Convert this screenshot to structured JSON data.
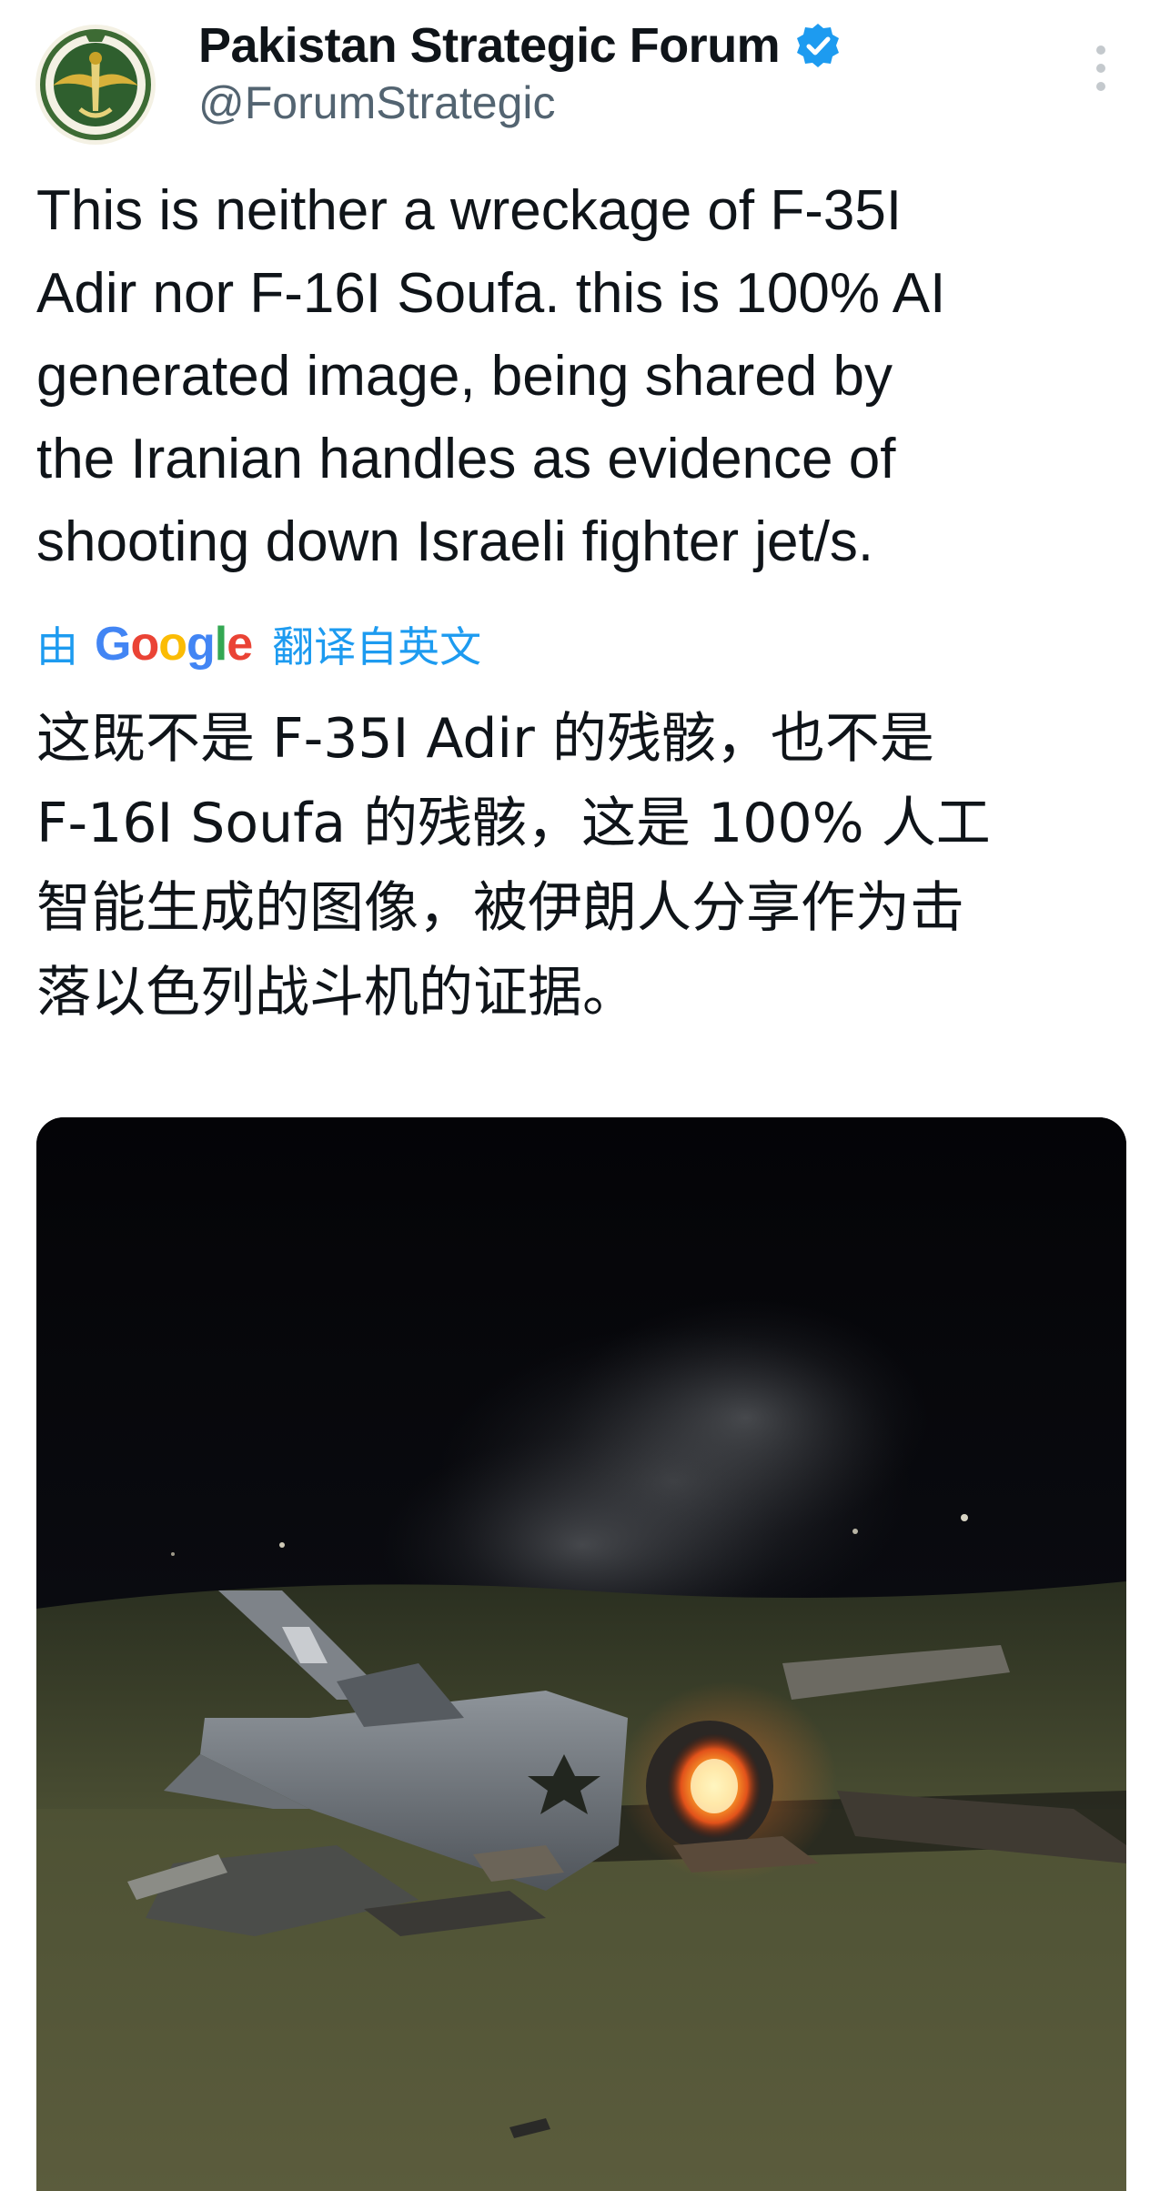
{
  "author": {
    "display_name": "Pakistan Strategic Forum",
    "handle": "@ForumStrategic",
    "avatar_icon": "emblem-avatar-icon",
    "verified": true,
    "verified_color": "#1d9bf0"
  },
  "menu": {
    "icon": "more-vertical-icon"
  },
  "tweet": {
    "text_lines": [
      "This is neither a wreckage of F-35I",
      "Adir nor F-16I Soufa. this is 100% AI",
      "generated image, being shared by",
      "the Iranian handles as evidence of",
      "shooting down Israeli fighter jet/s."
    ]
  },
  "translation": {
    "by_label": "由",
    "provider": "Google",
    "from_label": "翻译自英文",
    "link_color": "#1d9bf0",
    "text_lines": [
      "这既不是 F-35I Adir 的残骸，也不是",
      "F-16I Soufa 的残骸，这是 100% 人工",
      "智能生成的图像，被伊朗人分享作为击",
      "落以色列战斗机的证据。"
    ]
  },
  "media": {
    "type": "photo",
    "subject": "burning-jet-wreckage-photo"
  }
}
